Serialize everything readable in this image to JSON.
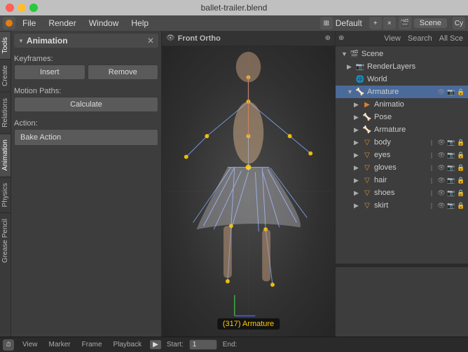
{
  "window": {
    "title": "ballet-trailer.blend",
    "traffic_lights": [
      "close",
      "minimize",
      "maximize"
    ]
  },
  "menubar": {
    "items": [
      "File",
      "Render",
      "Window",
      "Help"
    ],
    "workspace_label": "Default",
    "scene_label": "Scene"
  },
  "left_tabs": {
    "items": [
      "Tools",
      "Create",
      "Relations",
      "Animation",
      "Physics",
      "Grease Pencil"
    ]
  },
  "animation_panel": {
    "title": "Animation",
    "sections": {
      "keyframes": {
        "label": "Keyframes:",
        "insert_label": "Insert",
        "remove_label": "Remove"
      },
      "motion_paths": {
        "label": "Motion Paths:",
        "calculate_label": "Calculate"
      },
      "action": {
        "label": "Action:",
        "bake_label": "Bake Action"
      }
    }
  },
  "viewport": {
    "label": "Front Ortho",
    "armature_status": "(317) Armature"
  },
  "scene_panel": {
    "toolbar": {
      "view_label": "View",
      "search_label": "Search",
      "all_scenes_label": "All Sce"
    },
    "tree": [
      {
        "id": "scene",
        "label": "Scene",
        "icon": "scene",
        "level": 0,
        "expanded": true,
        "arrow": "▼"
      },
      {
        "id": "renderlayers",
        "label": "RenderLayers",
        "icon": "render",
        "level": 1,
        "expanded": false,
        "arrow": "▶"
      },
      {
        "id": "world",
        "label": "World",
        "icon": "world",
        "level": 1,
        "expanded": false,
        "arrow": ""
      },
      {
        "id": "armature",
        "label": "Armature",
        "icon": "armature",
        "level": 1,
        "expanded": true,
        "arrow": "▼",
        "selected": true
      },
      {
        "id": "animatio",
        "label": "Animatio",
        "icon": "anim",
        "level": 2,
        "expanded": false,
        "arrow": "▶"
      },
      {
        "id": "pose",
        "label": "Pose",
        "icon": "pose",
        "level": 2,
        "expanded": false,
        "arrow": "▶"
      },
      {
        "id": "armature2",
        "label": "Armature",
        "icon": "sub-arm",
        "level": 2,
        "expanded": false,
        "arrow": "▶"
      },
      {
        "id": "body",
        "label": "body",
        "icon": "mesh",
        "level": 2,
        "expanded": false,
        "arrow": "▶"
      },
      {
        "id": "eyes",
        "label": "eyes",
        "icon": "mesh",
        "level": 2,
        "expanded": false,
        "arrow": "▶"
      },
      {
        "id": "gloves",
        "label": "gloves",
        "icon": "mesh",
        "level": 2,
        "expanded": false,
        "arrow": "▶"
      },
      {
        "id": "hair",
        "label": "hair",
        "icon": "mesh",
        "level": 2,
        "expanded": false,
        "arrow": "▶"
      },
      {
        "id": "shoes",
        "label": "shoes",
        "icon": "mesh",
        "level": 2,
        "expanded": false,
        "arrow": "▶"
      },
      {
        "id": "skirt",
        "label": "skirt",
        "icon": "mesh",
        "level": 2,
        "expanded": false,
        "arrow": "▶"
      }
    ]
  },
  "statusbar": {
    "view_label": "View",
    "marker_label": "Marker",
    "frame_label": "Frame",
    "playback_label": "Playback",
    "start_label": "Start:",
    "start_value": "1",
    "end_label": "End:"
  }
}
